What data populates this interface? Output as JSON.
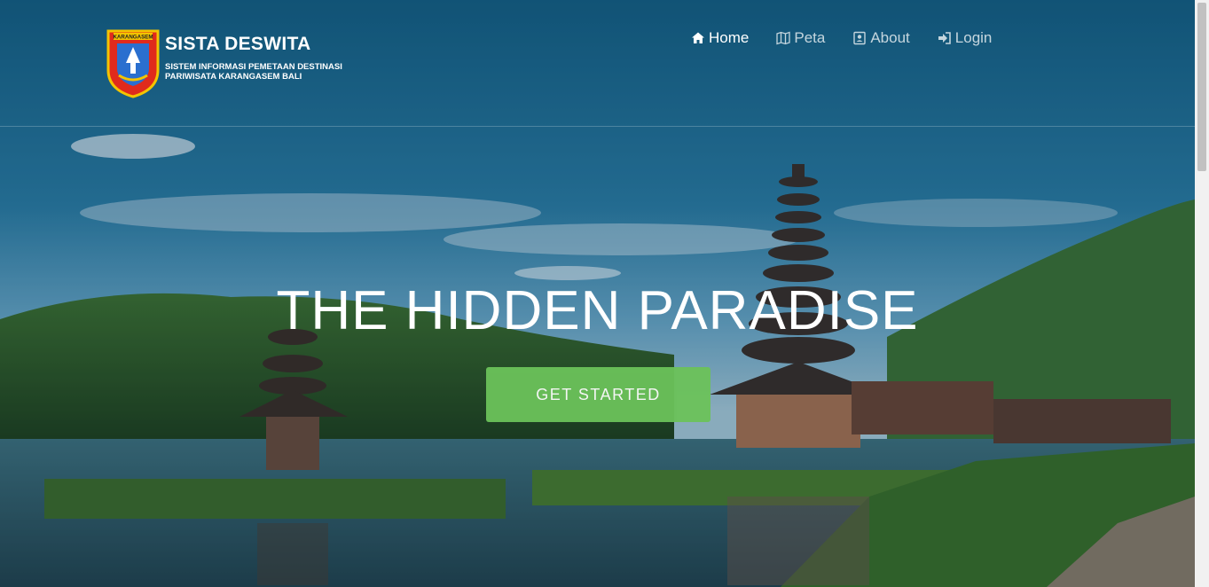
{
  "brand": {
    "title": "SISTA DESWITA",
    "subtitle": "SISTEM INFORMASI PEMETAAN DESTINASI PARIWISATA KARANGASEM BALI",
    "logo_text": "KARANGASEM"
  },
  "nav": {
    "items": [
      {
        "label": "Home",
        "icon": "home-icon",
        "active": true
      },
      {
        "label": "Peta",
        "icon": "map-icon",
        "active": false
      },
      {
        "label": "About",
        "icon": "contact-card-icon",
        "active": false
      },
      {
        "label": "Login",
        "icon": "sign-in-icon",
        "active": false
      }
    ]
  },
  "hero": {
    "title": "THE HIDDEN PARADISE",
    "cta_label": "GET STARTED"
  },
  "colors": {
    "cta": "#6bc25a",
    "header_text": "#ffffff",
    "sky": "#1f6a8f",
    "foliage": "#2f5a22"
  }
}
